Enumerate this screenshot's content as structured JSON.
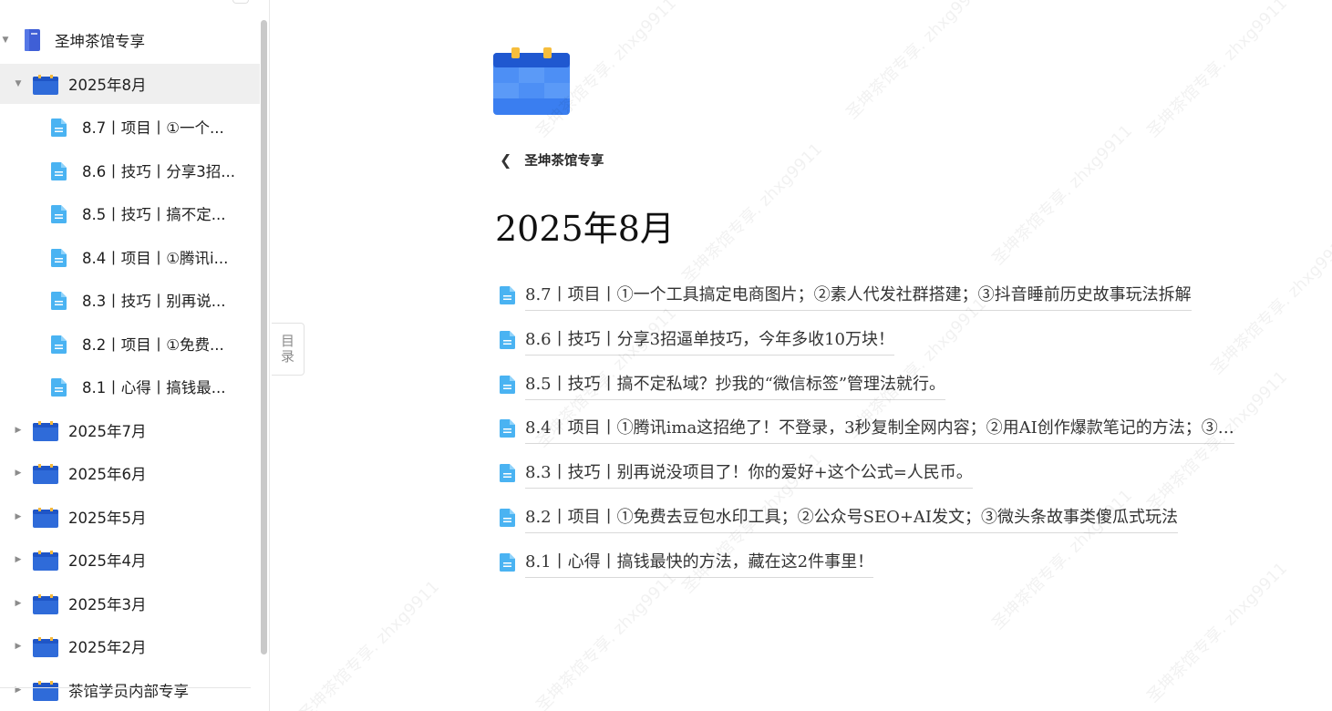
{
  "sidebar": {
    "root": {
      "label": "圣坤茶馆专享"
    },
    "current_month": {
      "label": "2025年8月"
    },
    "children": [
      {
        "label": "8.7丨项目丨①一个..."
      },
      {
        "label": "8.6丨技巧丨分享3招..."
      },
      {
        "label": "8.5丨技巧丨搞不定..."
      },
      {
        "label": "8.4丨项目丨①腾讯i..."
      },
      {
        "label": "8.3丨技巧丨别再说..."
      },
      {
        "label": "8.2丨项目丨①免费..."
      },
      {
        "label": "8.1丨心得丨搞钱最..."
      }
    ],
    "months": [
      {
        "label": "2025年7月"
      },
      {
        "label": "2025年6月"
      },
      {
        "label": "2025年5月"
      },
      {
        "label": "2025年4月"
      },
      {
        "label": "2025年3月"
      },
      {
        "label": "2025年2月"
      },
      {
        "label": "茶馆学员内部专享"
      }
    ]
  },
  "toc": {
    "label": "目录"
  },
  "main": {
    "back_label": "圣坤茶馆专享",
    "title": "2025年8月",
    "docs": [
      {
        "label": "8.7丨项目丨①一个工具搞定电商图片；②素人代发社群搭建；③抖音睡前历史故事玩法拆解"
      },
      {
        "label": "8.6丨技巧丨分享3招逼单技巧，今年多收10万块！"
      },
      {
        "label": "8.5丨技巧丨搞不定私域？抄我的“微信标签”管理法就行。"
      },
      {
        "label": "8.4丨项目丨①腾讯ima这招绝了！不登录，3秒复制全网内容；②用AI创作爆款笔记的方法；③…"
      },
      {
        "label": "8.3丨技巧丨别再说没项目了！你的爱好+这个公式=人民币。"
      },
      {
        "label": "8.2丨项目丨①免费去豆包水印工具；②公众号SEO+AI发文；③微头条故事类傻瓜式玩法"
      },
      {
        "label": "8.1丨心得丨搞钱最快的方法，藏在这2件事里！"
      }
    ]
  },
  "watermark": {
    "text": "圣坤茶馆专享. zhxg9911"
  },
  "colors": {
    "accent": "#2f6bd9",
    "doc_icon": "#4ab3f2",
    "active_row": "#efefef"
  }
}
